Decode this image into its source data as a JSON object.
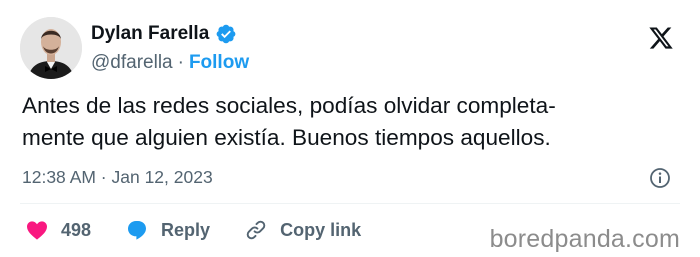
{
  "author": {
    "name": "Dylan Farella",
    "handle": "@dfarella",
    "separator": "·",
    "follow_label": "Follow"
  },
  "tweet": {
    "text": "Antes de las redes sociales, podías olvidar completa-\nmente que alguien existía. Buenos tiempos aquellos.",
    "timestamp": "12:38 AM · Jan 12, 2023"
  },
  "actions": {
    "likes": "498",
    "reply_label": "Reply",
    "copy_label": "Copy link"
  },
  "watermark": "boredpanda.com",
  "icons": {
    "verified": "verified-badge-icon",
    "logo": "x-logo-icon",
    "info": "info-icon",
    "like": "heart-icon",
    "reply": "speech-bubble-icon",
    "copy": "link-icon"
  },
  "colors": {
    "accent": "#1d9bf0",
    "like": "#f91880",
    "muted": "#536471",
    "text": "#0f1419"
  }
}
